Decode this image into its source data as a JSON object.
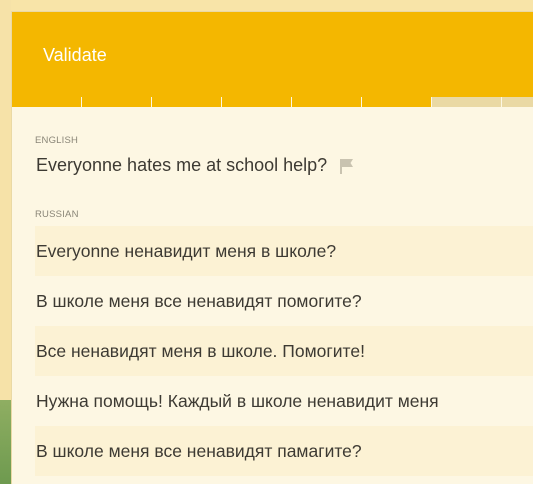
{
  "header": {
    "title": "Validate"
  },
  "progress": {
    "total_segments": 8,
    "completed_segments": 6
  },
  "source": {
    "language_label": "ENGLISH",
    "text": "Everyonne hates me at school help?",
    "flag_icon": "flag-icon"
  },
  "target": {
    "language_label": "RUSSIAN",
    "options": [
      "Everyonne ненавидит меня в школе?",
      "В школе меня все ненавидят помогите?",
      "Все ненавидят меня в школе. Помогите!",
      "Нужна помощь! Каждый в школе ненавидит меня",
      "В школе меня все ненавидят памагите?"
    ]
  },
  "colors": {
    "accent": "#f4b700",
    "card_bg": "#fdf7e3",
    "row_alt_bg": "#fcf2d4"
  }
}
